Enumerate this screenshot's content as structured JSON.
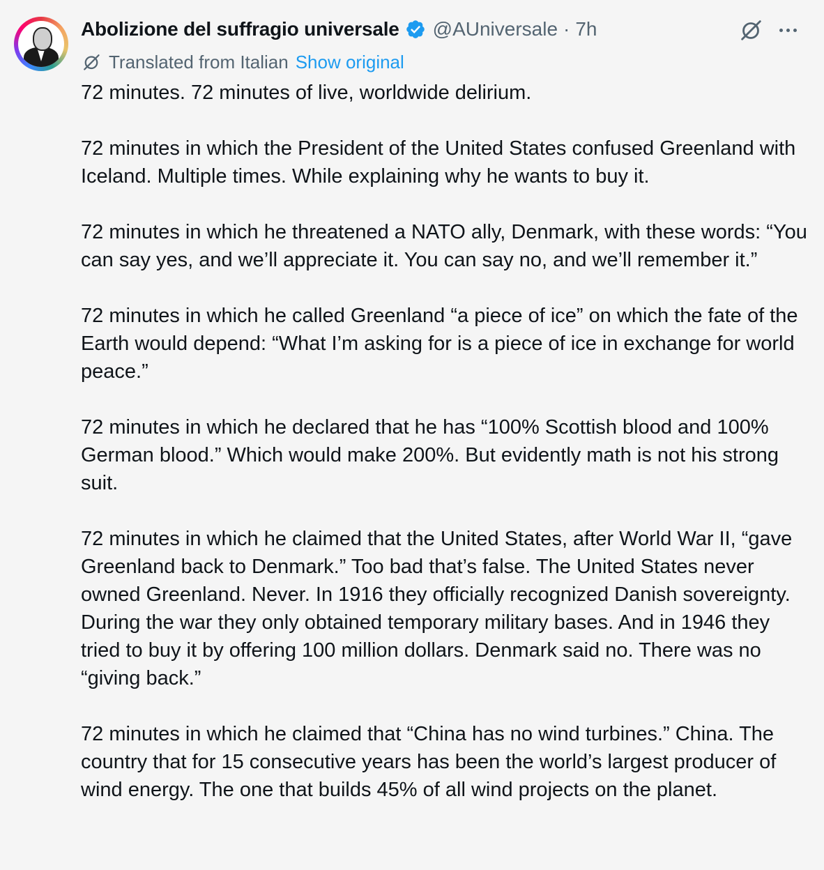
{
  "author": {
    "display_name": "Abolizione del suffragio universale",
    "handle": "@AUniversale",
    "separator": "·",
    "time": "7h",
    "verified_icon": "verified-badge-icon"
  },
  "colors": {
    "accent": "#1d9bf0",
    "text": "#0f1419",
    "muted": "#536471",
    "background": "#f5f5f5"
  },
  "translation": {
    "label": "Translated from Italian",
    "show_original": "Show original"
  },
  "paragraphs": [
    "72 minutes. 72 minutes of live, worldwide delirium.",
    "72 minutes in which the President of the United States confused Greenland with Iceland. Multiple times. While explaining why he wants to buy it.",
    "72 minutes in which he threatened a NATO ally, Denmark, with these words: “You can say yes, and we’ll appreciate it. You can say no, and we’ll remember it.”",
    "72 minutes in which he called Greenland “a piece of ice” on which the fate of the Earth would depend: “What I’m asking for is a piece of ice in exchange for world peace.”",
    "72 minutes in which he declared that he has “100% Scottish blood and 100% German blood.” Which would make 200%. But evidently math is not his strong suit.",
    "72 minutes in which he claimed that the United States, after World War II, “gave Greenland back to Denmark.” Too bad that’s false. The United States never owned Greenland. Never. In 1916 they officially recognized Danish sovereignty. During the war they only obtained temporary military bases. And in 1946 they tried to buy it by offering 100 million dollars. Denmark said no. There was no “giving back.”",
    "72 minutes in which he claimed that “China has no wind turbines.” China. The country that for 15 consecutive years has been the world’s largest producer of wind energy. The one that builds 45% of all wind projects on the planet."
  ]
}
